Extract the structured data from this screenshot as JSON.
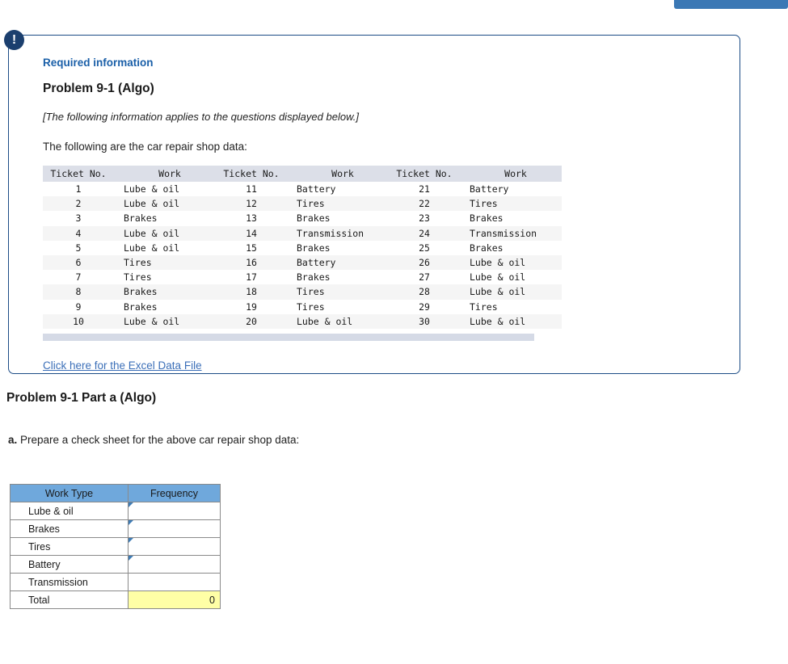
{
  "top_button": {
    "label": ""
  },
  "required_panel": {
    "alert_icon_glyph": "!",
    "label": "Required information",
    "problem_title": "Problem 9-1 (Algo)",
    "applies_note": "[The following information applies to the questions displayed below.]",
    "intro_text": "The following are the car repair shop data:",
    "excel_link": "Click here for the Excel Data File",
    "data_table": {
      "headers": [
        "Ticket No.",
        "Work",
        "Ticket No.",
        "Work",
        "Ticket No.",
        "Work"
      ],
      "rows": [
        [
          "1",
          "Lube & oil",
          "11",
          "Battery",
          "21",
          "Battery"
        ],
        [
          "2",
          "Lube & oil",
          "12",
          "Tires",
          "22",
          "Tires"
        ],
        [
          "3",
          "Brakes",
          "13",
          "Brakes",
          "23",
          "Brakes"
        ],
        [
          "4",
          "Lube & oil",
          "14",
          "Transmission",
          "24",
          "Transmission"
        ],
        [
          "5",
          "Lube & oil",
          "15",
          "Brakes",
          "25",
          "Brakes"
        ],
        [
          "6",
          "Tires",
          "16",
          "Battery",
          "26",
          "Lube & oil"
        ],
        [
          "7",
          "Tires",
          "17",
          "Brakes",
          "27",
          "Lube & oil"
        ],
        [
          "8",
          "Brakes",
          "18",
          "Tires",
          "28",
          "Lube & oil"
        ],
        [
          "9",
          "Brakes",
          "19",
          "Tires",
          "29",
          "Tires"
        ],
        [
          "10",
          "Lube & oil",
          "20",
          "Lube & oil",
          "30",
          "Lube & oil"
        ]
      ]
    }
  },
  "part_a": {
    "title": "Problem 9-1 Part a (Algo)",
    "question_label": "a.",
    "question_text": "Prepare a check sheet for the above car repair shop data:",
    "check_sheet": {
      "headers": [
        "Work Type",
        "Frequency"
      ],
      "rows": [
        {
          "label": "Lube & oil",
          "value": ""
        },
        {
          "label": "Brakes",
          "value": ""
        },
        {
          "label": "Tires",
          "value": ""
        },
        {
          "label": "Battery",
          "value": ""
        },
        {
          "label": "Transmission",
          "value": ""
        }
      ],
      "total_label": "Total",
      "total_value": "0"
    }
  },
  "colors": {
    "panel_border": "#1c4c86",
    "alert_badge": "#1b3f6e",
    "required_label": "#1a5fa8",
    "link": "#3b6fb8",
    "data_header_bg": "#dcdfe8",
    "data_footer_bg": "#d5dae6",
    "check_header_bg": "#6fa8dc",
    "input_border": "#3f7cb5",
    "total_bg": "#ffffa6",
    "top_button_bg": "#3b78b5"
  }
}
